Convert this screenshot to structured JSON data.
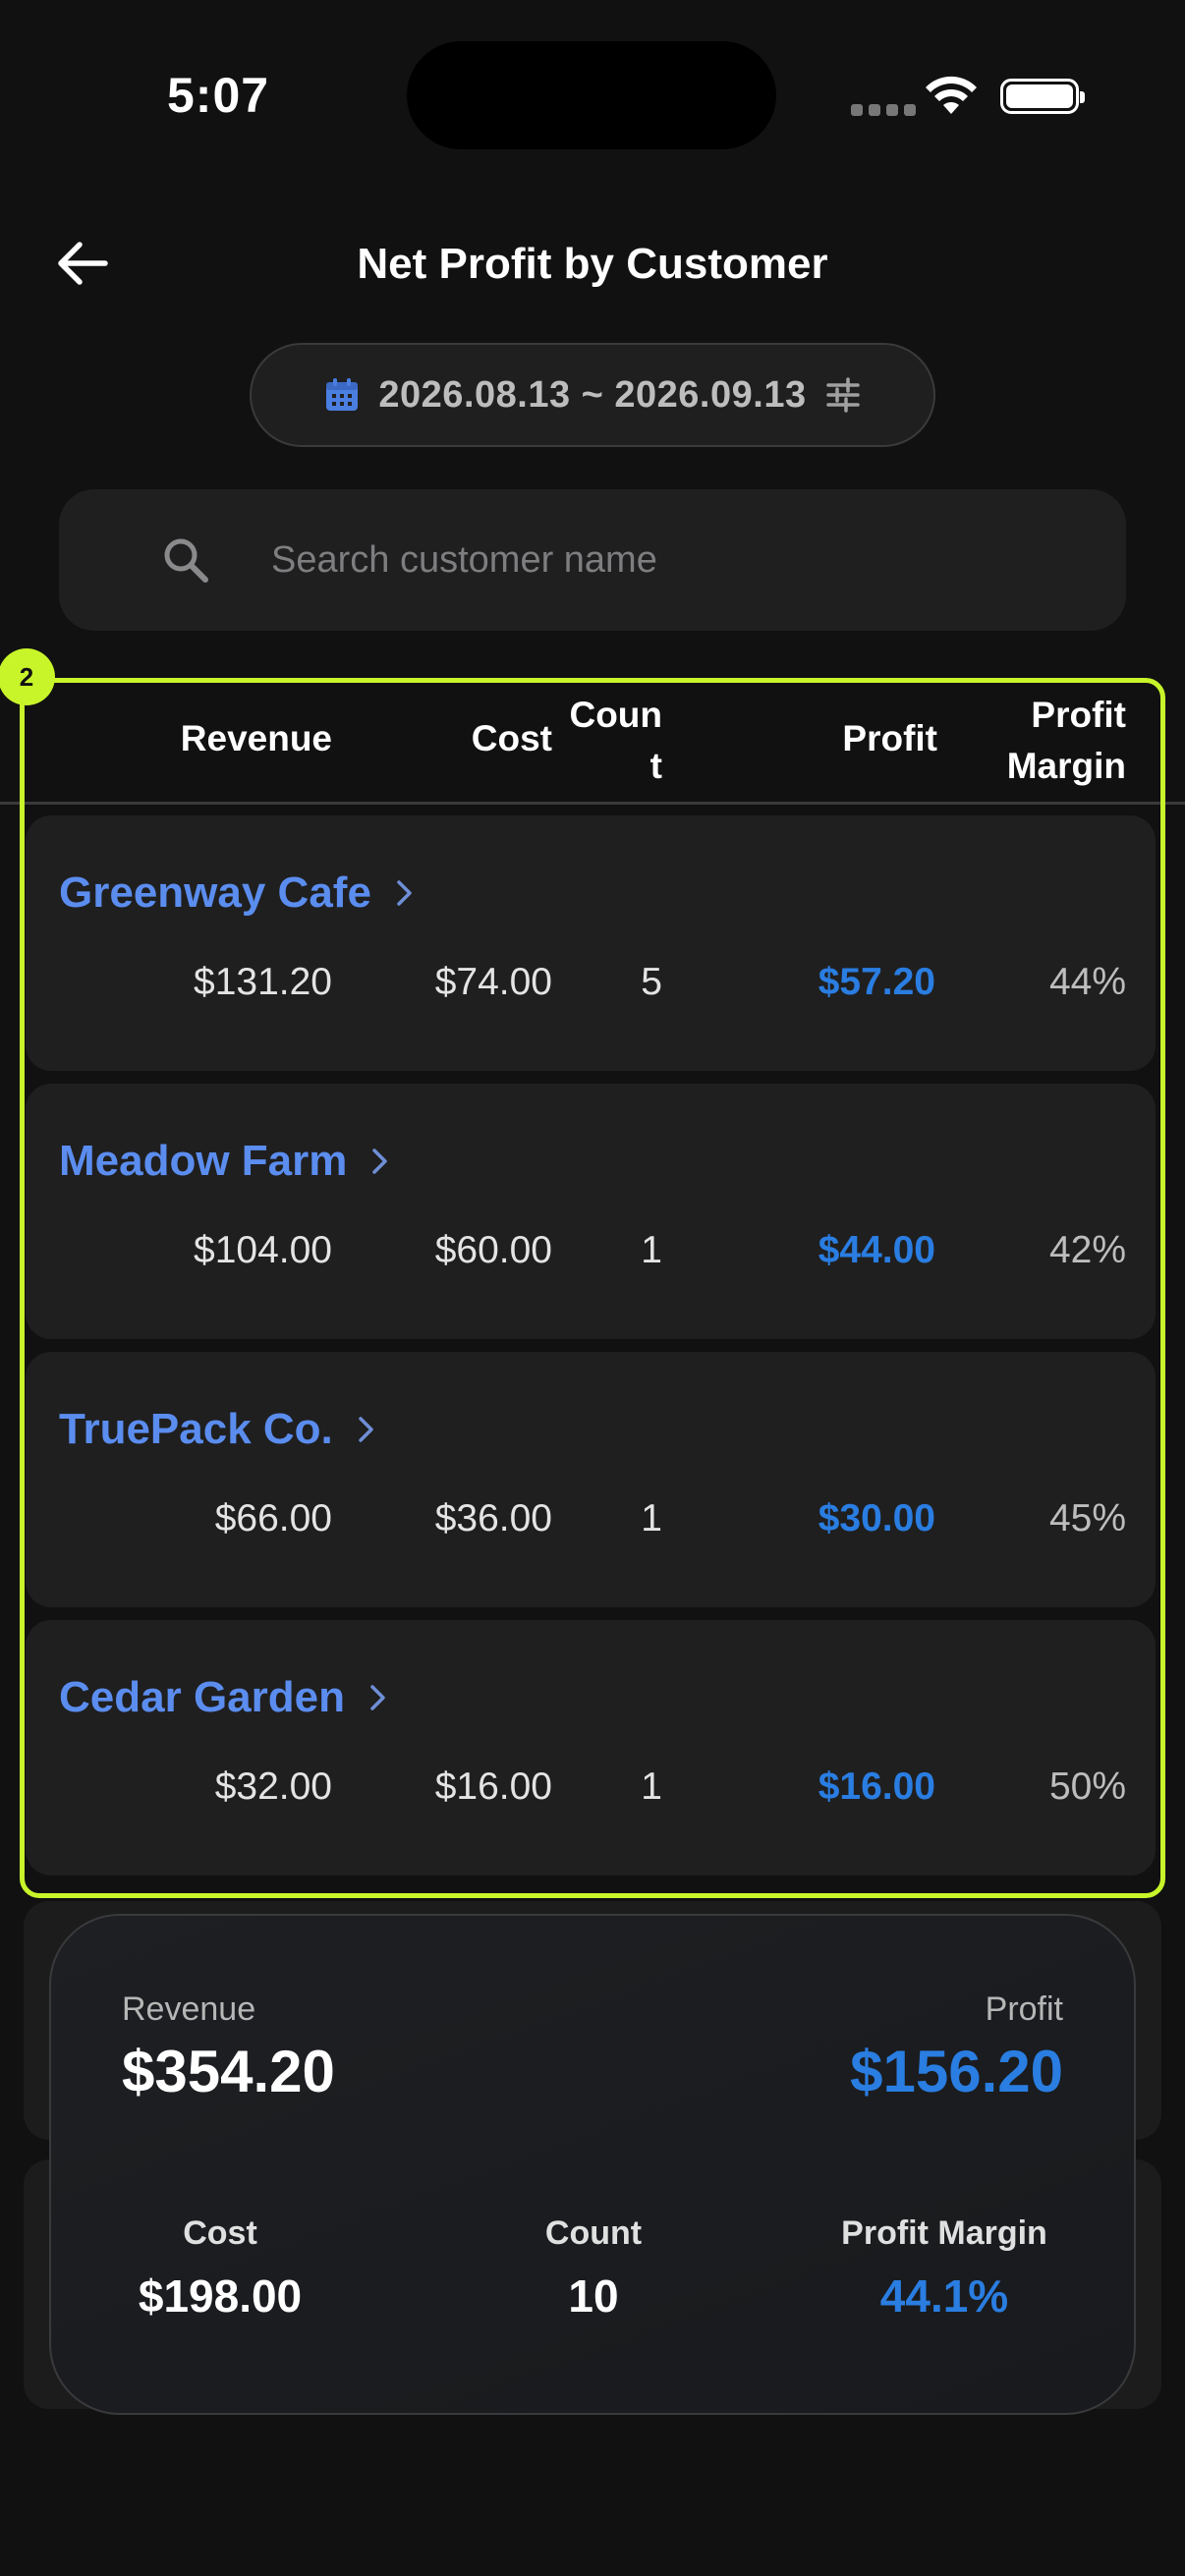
{
  "status_bar": {
    "time": "5:07"
  },
  "header": {
    "title": "Net Profit by Customer",
    "date_range": "2026.08.13 ~ 2026.09.13"
  },
  "search": {
    "placeholder": "Search customer name"
  },
  "highlight": {
    "badge": "2",
    "color": "#c8f52a"
  },
  "table": {
    "columns": {
      "revenue": "Revenue",
      "cost": "Cost",
      "count_line1": "Coun",
      "count_line2": "t",
      "profit": "Profit",
      "margin_line1": "Profit",
      "margin_line2": "Margin"
    },
    "rows": [
      {
        "name": "Greenway Cafe",
        "revenue": "$131.20",
        "cost": "$74.00",
        "count": "5",
        "profit": "$57.20",
        "margin": "44%"
      },
      {
        "name": "Meadow Farm",
        "revenue": "$104.00",
        "cost": "$60.00",
        "count": "1",
        "profit": "$44.00",
        "margin": "42%"
      },
      {
        "name": "TruePack Co.",
        "revenue": "$66.00",
        "cost": "$36.00",
        "count": "1",
        "profit": "$30.00",
        "margin": "45%"
      },
      {
        "name": "Cedar Garden",
        "revenue": "$32.00",
        "cost": "$16.00",
        "count": "1",
        "profit": "$16.00",
        "margin": "50%"
      }
    ]
  },
  "summary": {
    "revenue_label": "Revenue",
    "revenue": "$354.20",
    "profit_label": "Profit",
    "profit": "$156.20",
    "cost_label": "Cost",
    "cost": "$198.00",
    "count_label": "Count",
    "count": "10",
    "margin_label": "Profit Margin",
    "margin": "44.1%"
  },
  "colors": {
    "accent_blue": "#2a7de1",
    "name_blue": "#5b8def",
    "background": "#111111",
    "card": "#1f1f20"
  }
}
